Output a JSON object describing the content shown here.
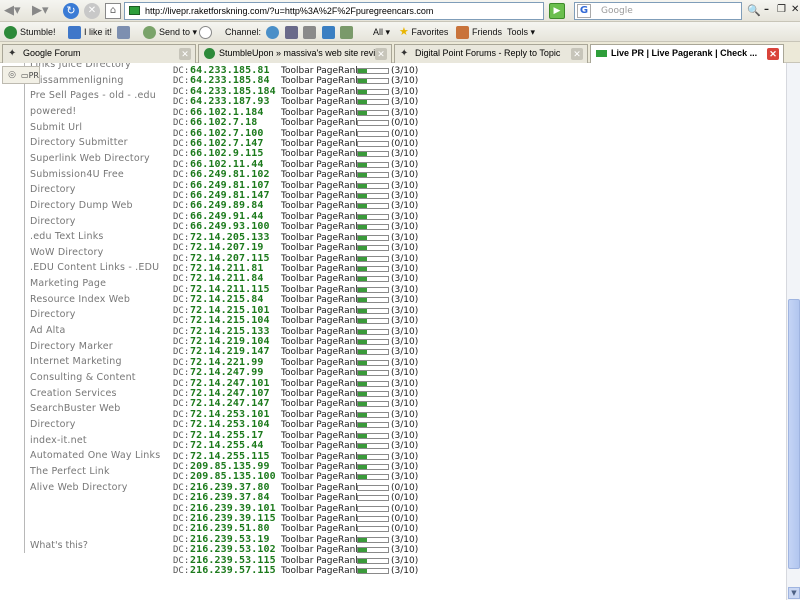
{
  "browser": {
    "url": "http://livepr.raketforskning.com/?u=http%3A%2F%2Fpuregreencars.com",
    "search_placeholder": "Google",
    "window_controls": [
      "–",
      "❐",
      "✕"
    ]
  },
  "toolbar": {
    "stumble_label": "Stumble!",
    "ilike_label": "I like it!",
    "sendto_label": "Send to",
    "channel_label": "Channel:",
    "all_label": "All",
    "favorites_label": "Favorites",
    "friends_label": "Friends",
    "tools_label": "Tools"
  },
  "tabs": [
    {
      "label": "Google Forum",
      "active": false
    },
    {
      "label": "StumbleUpon » massiva's web site revi...",
      "active": false
    },
    {
      "label": "Digital Point Forums - Reply to Topic",
      "active": false
    },
    {
      "label": "Live PR | Live Pagerank | Check ...",
      "active": true
    }
  ],
  "left_tools": {
    "icon1": "◎",
    "icon2": "▭PR"
  },
  "sidebar": {
    "links": [
      "Links Juice Directory",
      "Prissammenligning",
      "Pre Sell Pages - old - .edu",
      "powered!",
      "Submit Url",
      "Directory Submitter",
      "Superlink Web Directory",
      "Submission4U Free",
      "Directory",
      "Directory Dump Web",
      "Directory",
      ".edu Text Links",
      "WoW Directory",
      ".EDU Content Links - .EDU",
      "Marketing Page",
      "Resource Index Web",
      "Directory",
      "Ad Alta",
      "Directory Marker",
      "Internet Marketing",
      "Consulting & Content",
      "Creation Services",
      "SearchBuster Web",
      "Directory",
      "index-it.net",
      "Automated One Way Links",
      "The Perfect Link",
      "Alive Web Directory"
    ],
    "whats_this": "What's this?"
  },
  "results": {
    "dc_prefix": "DC:",
    "pr_label": "Toolbar PageRank:",
    "rows": [
      {
        "ip": "64.233.185.81",
        "score": "(3/10)",
        "fill": 0.3
      },
      {
        "ip": "64.233.185.84",
        "score": "(3/10)",
        "fill": 0.3
      },
      {
        "ip": "64.233.185.184",
        "score": "(3/10)",
        "fill": 0.3
      },
      {
        "ip": "64.233.187.93",
        "score": "(3/10)",
        "fill": 0.3
      },
      {
        "ip": "66.102.1.184",
        "score": "(3/10)",
        "fill": 0.3
      },
      {
        "ip": "66.102.7.18",
        "score": "(0/10)",
        "fill": 0.0
      },
      {
        "ip": "66.102.7.100",
        "score": "(0/10)",
        "fill": 0.0
      },
      {
        "ip": "66.102.7.147",
        "score": "(0/10)",
        "fill": 0.0
      },
      {
        "ip": "66.102.9.115",
        "score": "(3/10)",
        "fill": 0.3
      },
      {
        "ip": "66.102.11.44",
        "score": "(3/10)",
        "fill": 0.3
      },
      {
        "ip": "66.249.81.102",
        "score": "(3/10)",
        "fill": 0.3
      },
      {
        "ip": "66.249.81.107",
        "score": "(3/10)",
        "fill": 0.3
      },
      {
        "ip": "66.249.81.147",
        "score": "(3/10)",
        "fill": 0.3
      },
      {
        "ip": "66.249.89.84",
        "score": "(3/10)",
        "fill": 0.3
      },
      {
        "ip": "66.249.91.44",
        "score": "(3/10)",
        "fill": 0.3
      },
      {
        "ip": "66.249.93.100",
        "score": "(3/10)",
        "fill": 0.3
      },
      {
        "ip": "72.14.205.133",
        "score": "(3/10)",
        "fill": 0.3
      },
      {
        "ip": "72.14.207.19",
        "score": "(3/10)",
        "fill": 0.3
      },
      {
        "ip": "72.14.207.115",
        "score": "(3/10)",
        "fill": 0.3
      },
      {
        "ip": "72.14.211.81",
        "score": "(3/10)",
        "fill": 0.3
      },
      {
        "ip": "72.14.211.84",
        "score": "(3/10)",
        "fill": 0.3
      },
      {
        "ip": "72.14.211.115",
        "score": "(3/10)",
        "fill": 0.3
      },
      {
        "ip": "72.14.215.84",
        "score": "(3/10)",
        "fill": 0.3
      },
      {
        "ip": "72.14.215.101",
        "score": "(3/10)",
        "fill": 0.3
      },
      {
        "ip": "72.14.215.104",
        "score": "(3/10)",
        "fill": 0.3
      },
      {
        "ip": "72.14.215.133",
        "score": "(3/10)",
        "fill": 0.3
      },
      {
        "ip": "72.14.219.104",
        "score": "(3/10)",
        "fill": 0.3
      },
      {
        "ip": "72.14.219.147",
        "score": "(3/10)",
        "fill": 0.3
      },
      {
        "ip": "72.14.221.99",
        "score": "(3/10)",
        "fill": 0.3
      },
      {
        "ip": "72.14.247.99",
        "score": "(3/10)",
        "fill": 0.3
      },
      {
        "ip": "72.14.247.101",
        "score": "(3/10)",
        "fill": 0.3
      },
      {
        "ip": "72.14.247.107",
        "score": "(3/10)",
        "fill": 0.3
      },
      {
        "ip": "72.14.247.147",
        "score": "(3/10)",
        "fill": 0.3
      },
      {
        "ip": "72.14.253.101",
        "score": "(3/10)",
        "fill": 0.3
      },
      {
        "ip": "72.14.253.104",
        "score": "(3/10)",
        "fill": 0.3
      },
      {
        "ip": "72.14.255.17",
        "score": "(3/10)",
        "fill": 0.3
      },
      {
        "ip": "72.14.255.44",
        "score": "(3/10)",
        "fill": 0.3
      },
      {
        "ip": "72.14.255.115",
        "score": "(3/10)",
        "fill": 0.3
      },
      {
        "ip": "209.85.135.99",
        "score": "(3/10)",
        "fill": 0.3
      },
      {
        "ip": "209.85.135.100",
        "score": "(3/10)",
        "fill": 0.3
      },
      {
        "ip": "216.239.37.80",
        "score": "(0/10)",
        "fill": 0.0
      },
      {
        "ip": "216.239.37.84",
        "score": "(0/10)",
        "fill": 0.0
      },
      {
        "ip": "216.239.39.101",
        "score": "(0/10)",
        "fill": 0.0
      },
      {
        "ip": "216.239.39.115",
        "score": "(0/10)",
        "fill": 0.0
      },
      {
        "ip": "216.239.51.80",
        "score": "(0/10)",
        "fill": 0.0
      },
      {
        "ip": "216.239.53.19",
        "score": "(3/10)",
        "fill": 0.3
      },
      {
        "ip": "216.239.53.102",
        "score": "(3/10)",
        "fill": 0.3
      },
      {
        "ip": "216.239.53.115",
        "score": "(3/10)",
        "fill": 0.3
      },
      {
        "ip": "216.239.57.115",
        "score": "(3/10)",
        "fill": 0.3
      }
    ]
  },
  "colors": {
    "ip_green": "#1c7a1c",
    "bar_green": "#3a9a3a",
    "active_tab_close": "#d9433a"
  }
}
